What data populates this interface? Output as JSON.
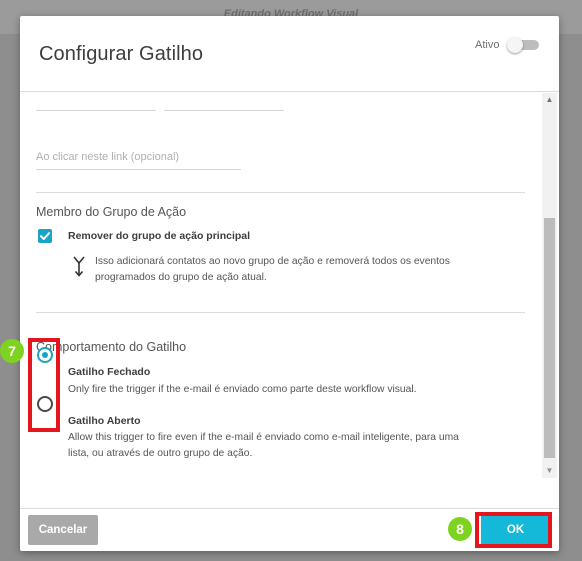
{
  "background": {
    "title": "Editando Workflow Visual"
  },
  "modal": {
    "title": "Configurar Gatilho",
    "active_label": "Ativo",
    "active_toggle_on": false
  },
  "link_field": {
    "placeholder": "Ao clicar neste link (opcional)"
  },
  "action_group": {
    "title": "Membro do Grupo de Ação",
    "checkbox_label": "Remover do grupo de ação principal",
    "checkbox_checked": true,
    "note_line1": "Isso adicionará contatos ao novo grupo de ação e removerá todos os eventos",
    "note_line2": "programados do grupo de ação atual."
  },
  "trigger_behavior": {
    "title": "Comportamento do Gatilho",
    "options": [
      {
        "label": "Gatilho Fechado",
        "description_line1": "Only fire the trigger if the e-mail é enviado como parte deste workflow visual.",
        "description_line2": "",
        "selected": true
      },
      {
        "label": "Gatilho Aberto",
        "description_line1": "Allow this trigger to fire even if the e-mail é enviado como e-mail inteligente, para uma",
        "description_line2": "lista, ou através de outro grupo de ação.",
        "selected": false
      }
    ]
  },
  "footer": {
    "cancel_label": "Cancelar",
    "ok_label": "OK"
  },
  "annotations": {
    "step_radio": "7",
    "step_ok": "8"
  },
  "colors": {
    "accent": "#1aa3c9",
    "ok_button": "#14b8d8",
    "highlight": "#e3161d",
    "badge": "#7ed321"
  }
}
